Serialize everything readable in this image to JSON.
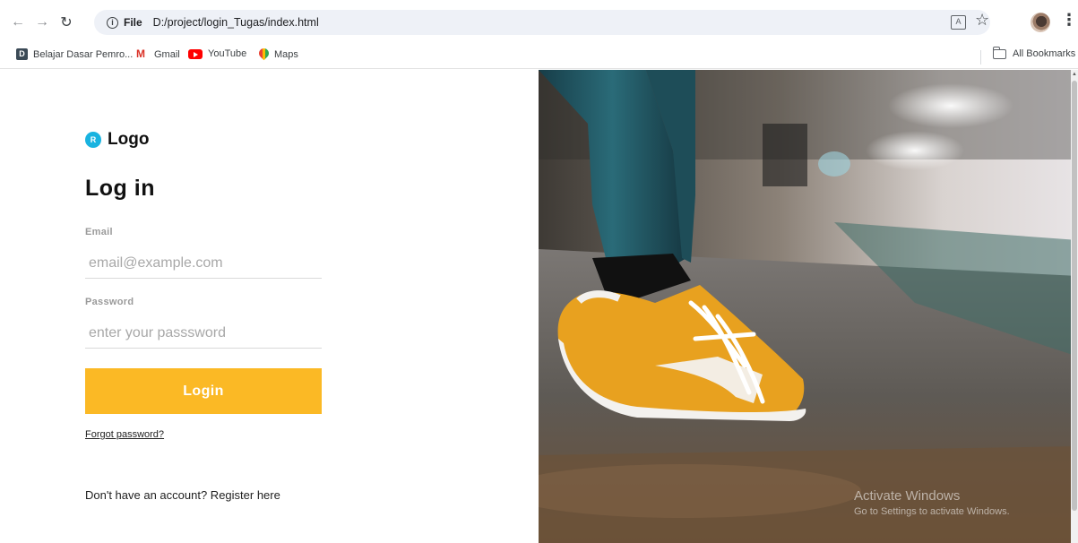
{
  "browser": {
    "site_chip": "File",
    "url": "D:/project/login_Tugas/index.html",
    "bookmarks": [
      {
        "label": "Belajar Dasar Pemro...",
        "icon": "dicoding-icon"
      },
      {
        "label": "Gmail",
        "icon": "gmail-icon"
      },
      {
        "label": "YouTube",
        "icon": "youtube-icon"
      },
      {
        "label": "Maps",
        "icon": "maps-icon"
      }
    ],
    "all_bookmarks": "All Bookmarks"
  },
  "login": {
    "logo_mark": "R",
    "logo_text": "Logo",
    "title": "Log in",
    "email_label": "Email",
    "email_placeholder": "email@example.com",
    "password_label": "Password",
    "password_placeholder": "enter your passsword",
    "login_button": "Login",
    "forgot_password": "Forgot password?",
    "register_text": "Don't have an account? Register here"
  },
  "watermark": {
    "title": "Activate Windows",
    "subtitle": "Go to Settings to activate Windows."
  },
  "colors": {
    "accent": "#fbb925",
    "logo": "#19b3e0"
  }
}
